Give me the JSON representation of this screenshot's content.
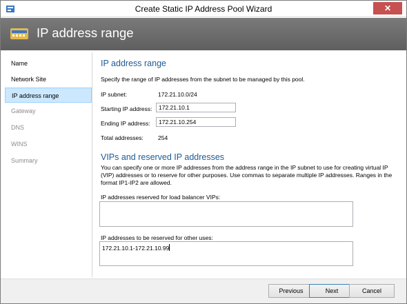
{
  "window": {
    "title": "Create Static IP Address Pool Wizard",
    "close_glyph": "✕"
  },
  "header": {
    "title": "IP address range"
  },
  "nav": {
    "items": [
      {
        "label": "Name"
      },
      {
        "label": "Network Site"
      },
      {
        "label": "IP address range"
      },
      {
        "label": "Gateway"
      },
      {
        "label": "DNS"
      },
      {
        "label": "WINS"
      },
      {
        "label": "Summary"
      }
    ],
    "selected": "IP address range"
  },
  "main": {
    "section1_title": "IP address range",
    "section1_desc": "Specify the range of IP addresses from the subnet to be managed by this pool.",
    "ip_subnet_label": "IP subnet:",
    "ip_subnet_value": "172.21.10.0/24",
    "start_label": "Starting IP address:",
    "start_value": "172.21.10.1",
    "end_label": "Ending IP address:",
    "end_value": "172.21.10.254",
    "total_label": "Total addresses:",
    "total_value": "254",
    "section2_title": "VIPs and reserved IP addresses",
    "section2_desc": "You can specify one or more IP addresses from the address range in the IP subnet to use for creating virtual IP (VIP) addresses or to reserve for other purposes. Use commas to separate multiple IP addresses. Ranges in the format IP1-IP2 are allowed.",
    "vip_label": "IP addresses reserved for load balancer VIPs:",
    "vip_value": "",
    "other_label": "IP addresses to be reserved for other uses:",
    "other_value": "172.21.10.1-172.21.10.99"
  },
  "footer": {
    "previous": "Previous",
    "next": "Next",
    "cancel": "Cancel"
  },
  "colors": {
    "accent_heading": "#1e5a96",
    "header_bg": "#6b6b6b",
    "selected_nav": "#cce8ff",
    "close_button": "#c75050"
  }
}
